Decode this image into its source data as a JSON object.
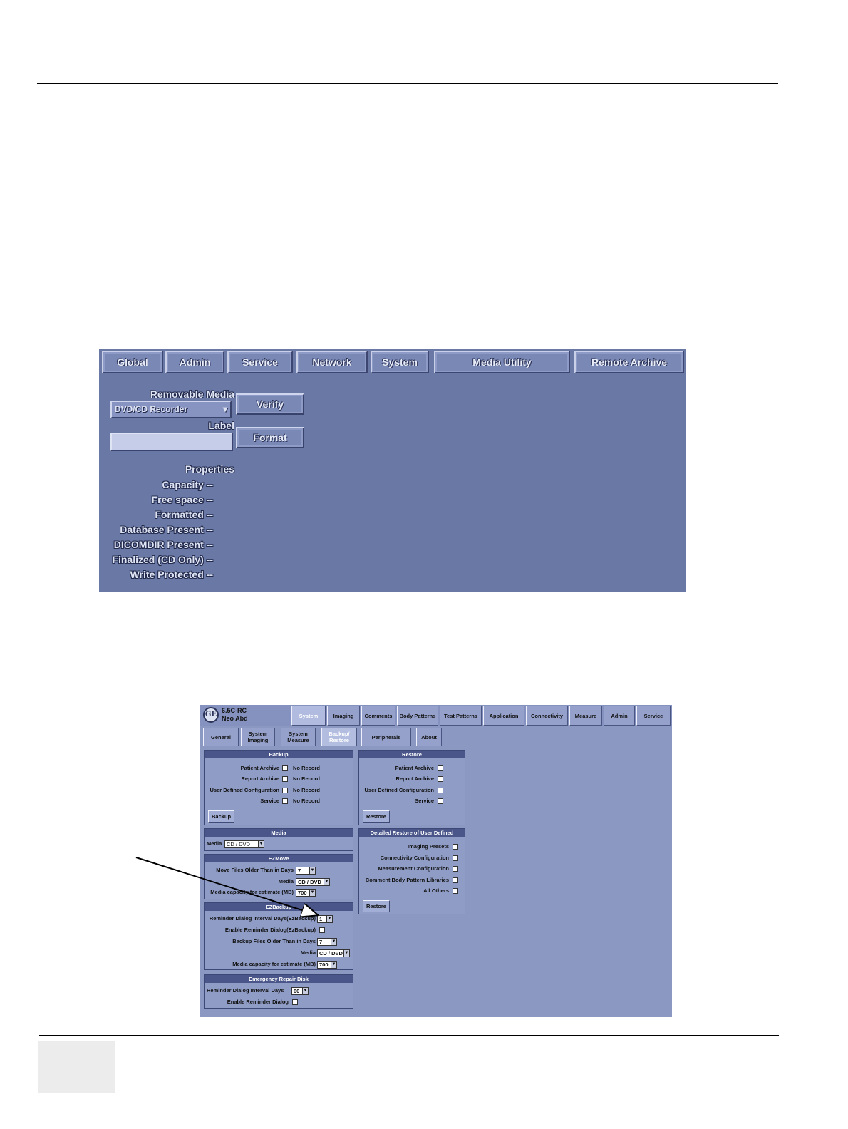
{
  "media_utility": {
    "tabs": [
      "Global",
      "Admin",
      "Service",
      "Network",
      "System",
      "Media Utility",
      "Remote Archive"
    ],
    "removable_media_label": "Removable Media",
    "selected_media": "DVD/CD Recorder",
    "verify_button": "Verify",
    "label_label": "Label",
    "label_value": "",
    "format_button": "Format",
    "properties_heading": "Properties",
    "properties": [
      {
        "label": "Capacity",
        "value": "--"
      },
      {
        "label": "Free space",
        "value": "--"
      },
      {
        "label": "Formatted",
        "value": "--"
      },
      {
        "label": "Database Present",
        "value": "--"
      },
      {
        "label": "DICOMDIR Present",
        "value": "--"
      },
      {
        "label": "Finalized (CD Only)",
        "value": "--"
      },
      {
        "label": "Write Protected",
        "value": "--"
      }
    ]
  },
  "backup_restore": {
    "logo": "GE",
    "version": "6.5C-RC",
    "preset": "Neo Abd",
    "tabs": [
      "System",
      "Imaging",
      "Comments",
      "Body Patterns",
      "Test Patterns",
      "Application",
      "Connectivity",
      "Measure",
      "Admin",
      "Service"
    ],
    "active_tab": "System",
    "subtabs": [
      "General",
      "System Imaging",
      "System Measure",
      "Backup/ Restore",
      "Peripherals",
      "About"
    ],
    "active_subtab": "Backup/ Restore",
    "backup": {
      "title": "Backup",
      "items": [
        {
          "label": "Patient Archive",
          "status": "No Record",
          "checked": false
        },
        {
          "label": "Report Archive",
          "status": "No Record",
          "checked": false
        },
        {
          "label": "User Defined Configuration",
          "status": "No Record",
          "checked": false
        },
        {
          "label": "Service",
          "status": "No Record",
          "checked": false
        }
      ],
      "button": "Backup"
    },
    "restore": {
      "title": "Restore",
      "items": [
        {
          "label": "Patient Archive",
          "checked": false
        },
        {
          "label": "Report Archive",
          "checked": false
        },
        {
          "label": "User Defined Configuration",
          "checked": false
        },
        {
          "label": "Service",
          "checked": false
        }
      ],
      "button": "Restore"
    },
    "media": {
      "title": "Media",
      "label": "Media",
      "value": "CD / DVD"
    },
    "detailed_restore": {
      "title": "Detailed Restore of User Defined",
      "items": [
        {
          "label": "Imaging Presets",
          "checked": false
        },
        {
          "label": "Connectivity Configuration",
          "checked": false
        },
        {
          "label": "Measurement Configuration",
          "checked": false
        },
        {
          "label": "Comment Body Pattern Libraries",
          "checked": false
        },
        {
          "label": "All Others",
          "checked": false
        }
      ],
      "button": "Restore"
    },
    "ezmove": {
      "title": "EZMove",
      "older_label": "Move Files Older Than in Days",
      "older_value": "7",
      "media_label": "Media",
      "media_value": "CD / DVD",
      "capacity_label": "Media capacity for estimate (MB)",
      "capacity_value": "700"
    },
    "ezbackup": {
      "title": "EZBackup",
      "interval_label": "Reminder Dialog Interval Days(EzBackup)",
      "interval_value": "1",
      "enable_label": "Enable Reminder Dialog(EzBackup)",
      "enable_checked": false,
      "older_label": "Backup Files Older Than in Days",
      "older_value": "7",
      "media_label": "Media",
      "media_value": "CD / DVD",
      "capacity_label": "Media capacity for estimate (MB)",
      "capacity_value": "700"
    },
    "emergency": {
      "title": "Emergency Repair Disk",
      "interval_label": "Reminder Dialog Interval Days",
      "interval_value": "60",
      "enable_label": "Enable Reminder Dialog",
      "enable_checked": false
    }
  },
  "colors": {
    "shot1_background": "#6a78a5",
    "shot2_background": "#8b98c2",
    "panel_title": "#4a5689"
  }
}
